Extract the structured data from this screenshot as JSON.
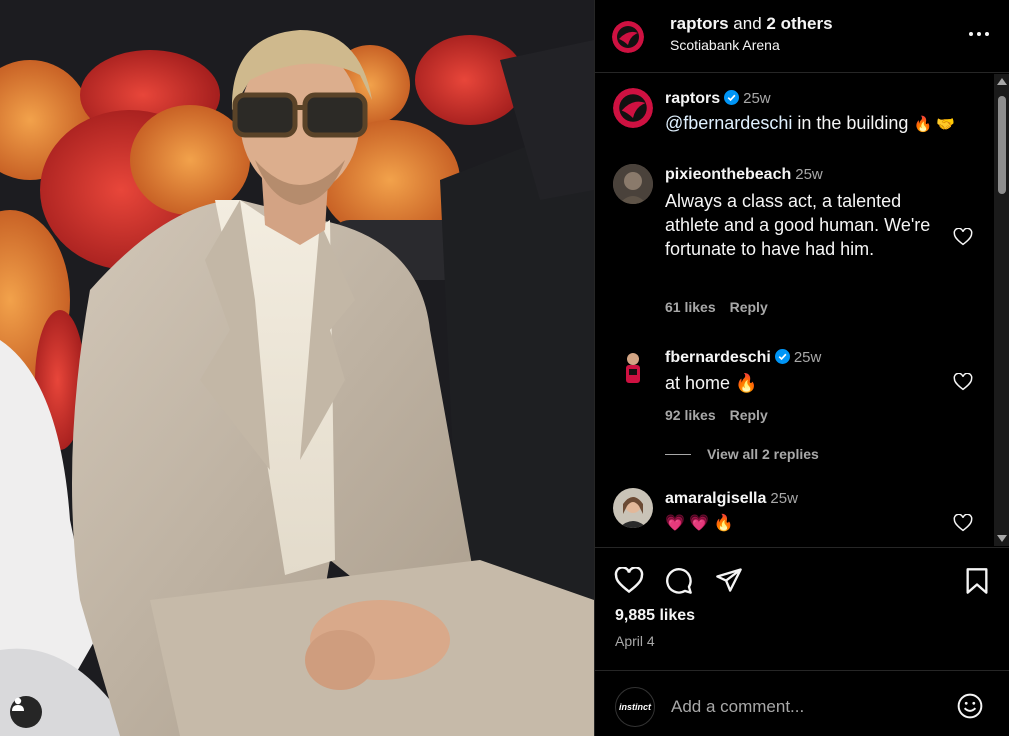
{
  "post": {
    "author": "raptors",
    "collab_text": " and ",
    "others": "2 others",
    "location": "Scotiabank Arena"
  },
  "caption": {
    "user": "raptors",
    "time": "25w",
    "mention": "@fbernardeschi",
    "text": " in the building ",
    "emoji": "🔥 🤝"
  },
  "comments": [
    {
      "user": "pixieonthebeach",
      "time": "25w",
      "text": "Always a class act, a talented athlete and a good human. We're fortunate to have had him.",
      "likes": "61 likes",
      "reply_label": "Reply"
    },
    {
      "user": "fbernardeschi",
      "time": "25w",
      "text": "at home 🔥",
      "likes": "92 likes",
      "reply_label": "Reply",
      "view_replies": "View all 2 replies"
    },
    {
      "user": "amaralgisella",
      "time": "25w",
      "text": "💗 💗 🔥"
    }
  ],
  "engagement": {
    "likes": "9,885 likes",
    "date": "April 4"
  },
  "add_comment": {
    "placeholder": "Add a comment...",
    "avatar_text": "instinct"
  },
  "colors": {
    "background": "#000000",
    "verified": "#0095f6",
    "muted_text": "#a8a8a8",
    "raptors_red": "#ce1141"
  },
  "icons": [
    "more-icon",
    "verified-icon",
    "heart-icon",
    "comment-icon",
    "share-icon",
    "bookmark-icon",
    "emoji-icon",
    "tag-user-icon"
  ]
}
